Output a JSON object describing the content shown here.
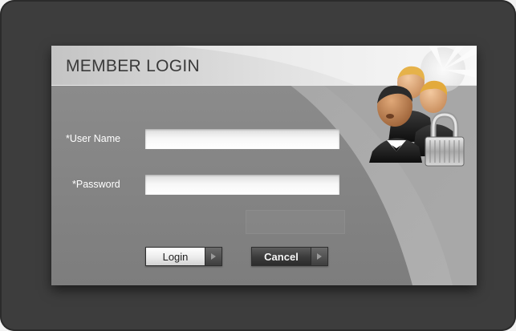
{
  "dialog": {
    "title": "MEMBER LOGIN"
  },
  "form": {
    "username": {
      "label": "*User Name",
      "value": "",
      "placeholder": ""
    },
    "password": {
      "label": "*Password",
      "value": "",
      "placeholder": ""
    }
  },
  "buttons": {
    "login_label": "Login",
    "cancel_label": "Cancel",
    "arrow_icon": "play-triangle-icon"
  },
  "icons": {
    "header_graphic": "users-lock-icon"
  },
  "colors": {
    "frame": "#3d3d3d",
    "panel": "#8f8f8f",
    "title_text": "#3a3a3a",
    "label_text": "#ffffff",
    "login_button": "#f0f0f0",
    "cancel_button": "#3a3a3a"
  }
}
